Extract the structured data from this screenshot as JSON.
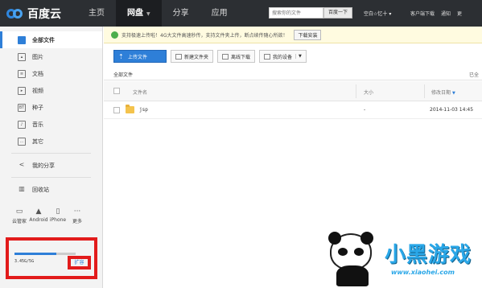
{
  "topbar": {
    "logo_text": "百度云",
    "nav": [
      {
        "label": "主页",
        "active": false
      },
      {
        "label": "网盘",
        "active": true
      },
      {
        "label": "分享",
        "active": false
      },
      {
        "label": "应用",
        "active": false
      }
    ],
    "search_placeholder": "搜索你的文件",
    "search_button": "百度一下",
    "user_name": "空白☆忆十",
    "links": [
      "客户端下载",
      "通知",
      "更"
    ]
  },
  "sidebar": {
    "items": [
      {
        "label": "全部文件",
        "icon": "folder-icon",
        "active": true
      },
      {
        "label": "图片",
        "icon": "image-icon",
        "active": false
      },
      {
        "label": "文档",
        "icon": "document-icon",
        "active": false
      },
      {
        "label": "视频",
        "icon": "video-icon",
        "active": false
      },
      {
        "label": "种子",
        "icon": "torrent-icon",
        "icon_text": "BT",
        "active": false
      },
      {
        "label": "音乐",
        "icon": "music-icon",
        "active": false
      },
      {
        "label": "其它",
        "icon": "other-icon",
        "active": false
      }
    ],
    "share_label": "我的分享",
    "recycle_label": "回收站",
    "devices": [
      {
        "label": "云管家",
        "icon": "desktop-icon"
      },
      {
        "label": "Android",
        "icon": "android-icon"
      },
      {
        "label": "iPhone",
        "icon": "iphone-icon"
      },
      {
        "label": "更多",
        "icon": "more-icon"
      }
    ],
    "storage": {
      "text": "3.45G/5G",
      "used_fraction": 0.69,
      "expand_label": "扩容"
    }
  },
  "notice": {
    "text": "支持极速上传啦！4G大文件高速秒传，支持文件夹上传，断点续传随心所欲！",
    "button": "下载安装"
  },
  "toolbar": {
    "upload": "上传文件",
    "new_folder": "新建文件夹",
    "offline": "离线下载",
    "devices": "我的设备"
  },
  "breadcrumb": {
    "path": "全部文件",
    "right": "已全"
  },
  "table": {
    "headers": {
      "name": "文件名",
      "size": "大小",
      "date": "修改日期"
    },
    "rows": [
      {
        "name": "jsp",
        "size": "-",
        "date": "2014-11-03 14:45"
      }
    ]
  },
  "watermark": {
    "brand": "小黑游戏",
    "url": "www.xiaohei.com"
  },
  "colors": {
    "accent": "#2e7fd8",
    "topbar": "#2c2f33",
    "highlight": "#e21b1b"
  }
}
